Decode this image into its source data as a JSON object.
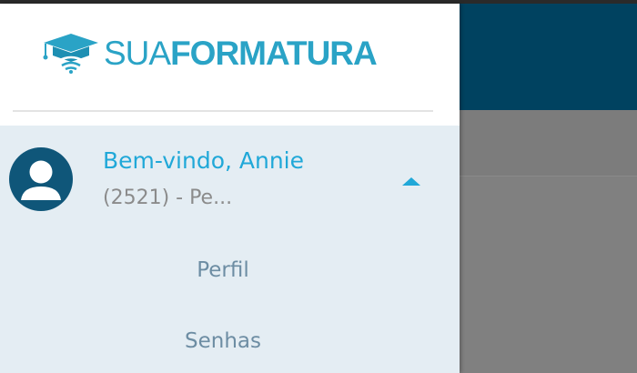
{
  "brand": {
    "word1": "SUA",
    "word2": "FORMATURA",
    "icon": "graduation-cap-wifi-icon",
    "color": "#2aa3c6"
  },
  "user": {
    "welcome": "Bem-vindo, Annie",
    "account": "(2521) - Pe...",
    "avatar_icon": "user-avatar-icon",
    "expand_icon": "caret-up-icon"
  },
  "menu": {
    "items": [
      {
        "label": "Perfil"
      },
      {
        "label": "Senhas"
      }
    ]
  },
  "colors": {
    "header_dark": "#004260",
    "overlay": "#808080",
    "panel_bg": "#e4edf3",
    "accent": "#20a8d8",
    "avatar_bg": "#0f5679"
  }
}
